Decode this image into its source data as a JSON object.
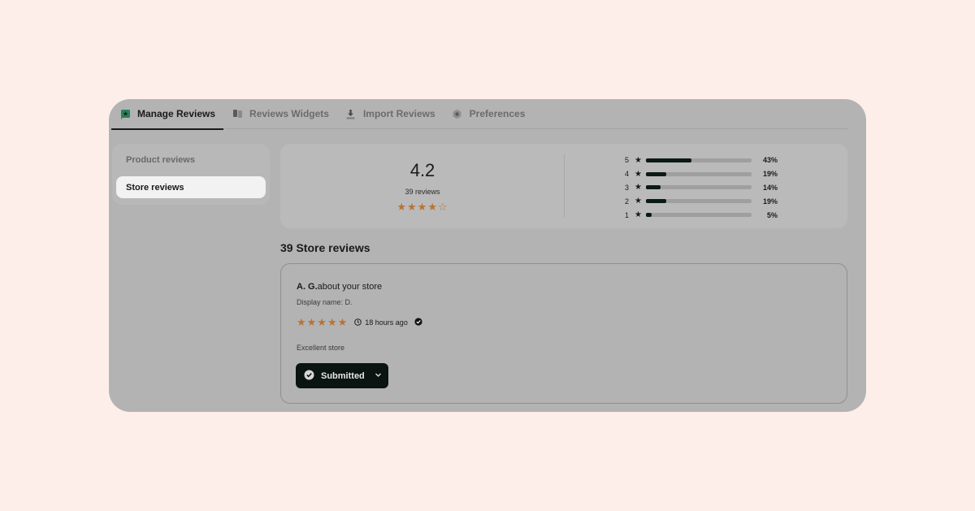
{
  "tabs": [
    {
      "label": "Manage Reviews",
      "icon": "star-flag-icon",
      "active": true
    },
    {
      "label": "Reviews Widgets",
      "icon": "widgets-icon",
      "active": false
    },
    {
      "label": "Import Reviews",
      "icon": "download-icon",
      "active": false
    },
    {
      "label": "Preferences",
      "icon": "gear-icon",
      "active": false
    }
  ],
  "sidebar": {
    "items": [
      {
        "label": "Product reviews",
        "active": false
      },
      {
        "label": "Store reviews",
        "active": true
      }
    ]
  },
  "summary": {
    "average": "4.2",
    "count_label": "39 reviews",
    "stars": "★★★★☆",
    "distribution": [
      {
        "stars": "5",
        "percent_label": "43%",
        "fraction": 0.43
      },
      {
        "stars": "4",
        "percent_label": "19%",
        "fraction": 0.19
      },
      {
        "stars": "3",
        "percent_label": "14%",
        "fraction": 0.14
      },
      {
        "stars": "2",
        "percent_label": "19%",
        "fraction": 0.19
      },
      {
        "stars": "1",
        "percent_label": "5%",
        "fraction": 0.05
      }
    ]
  },
  "section_title": "39 Store reviews",
  "review": {
    "author": "A. G.",
    "about": "about your store",
    "display_name": "Display name: D.",
    "stars": "★★★★★",
    "time_ago": "18 hours ago",
    "body": "Excellent store",
    "status_label": "Submitted"
  },
  "colors": {
    "accent_star": "#b87333",
    "button_dark": "#0a1410",
    "page_background": "#fdeeea"
  }
}
